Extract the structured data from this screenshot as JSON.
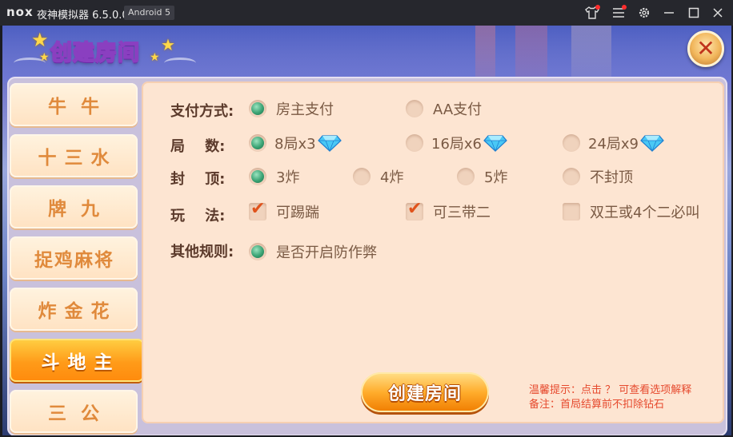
{
  "window": {
    "logo": "nox",
    "title": "夜神模拟器 6.5.0.0",
    "android_badge": "Android 5",
    "icons": [
      "shirt-icon",
      "menu-icon",
      "settings-icon",
      "minimize-icon",
      "maximize-icon",
      "close-icon"
    ]
  },
  "dialog": {
    "title": "创建房间",
    "close_icon": "close-x-icon"
  },
  "sidebar": {
    "tabs": [
      {
        "label": "牛牛",
        "active": false
      },
      {
        "label": "十三水",
        "active": false
      },
      {
        "label": "牌九",
        "active": false
      },
      {
        "label": "捉鸡麻将",
        "active": false
      },
      {
        "label": "炸金花",
        "active": false
      },
      {
        "label": "斗地主",
        "active": true
      },
      {
        "label": "三公",
        "active": false
      }
    ]
  },
  "rules": {
    "payment": {
      "label": "支付方式:",
      "options": [
        {
          "label": "房主支付",
          "selected": true
        },
        {
          "label": "AA支付",
          "selected": false
        }
      ]
    },
    "rounds": {
      "label": "局    数:",
      "options": [
        {
          "label": "8局x3",
          "selected": true,
          "icon": "diamond-icon"
        },
        {
          "label": "16局x6",
          "selected": false,
          "icon": "diamond-icon"
        },
        {
          "label": "24局x9",
          "selected": false,
          "icon": "diamond-icon"
        }
      ]
    },
    "cap": {
      "label": "封    顶:",
      "options": [
        {
          "label": "3炸",
          "selected": true
        },
        {
          "label": "4炸",
          "selected": false
        },
        {
          "label": "5炸",
          "selected": false
        },
        {
          "label": "不封顶",
          "selected": false
        }
      ]
    },
    "play": {
      "label": "玩    法:",
      "options": [
        {
          "label": "可踢踹",
          "checked": true
        },
        {
          "label": "可三带二",
          "checked": true
        },
        {
          "label": "双王或4个二必叫",
          "checked": false
        }
      ]
    },
    "other": {
      "label": "其他规则:",
      "options": [
        {
          "label": "是否开启防作弊",
          "selected": true
        }
      ]
    }
  },
  "create_button": "创建房间",
  "tips": {
    "line1": "温馨提示：点击 ？ 可查看选项解释",
    "line2": "备注：首局结算前不扣除钻石"
  },
  "colors": {
    "accent_orange": "#ff9b19",
    "radio_green": "#3aa374",
    "panel_bg": "#fde5d2",
    "tip_red": "#e64a2e"
  }
}
